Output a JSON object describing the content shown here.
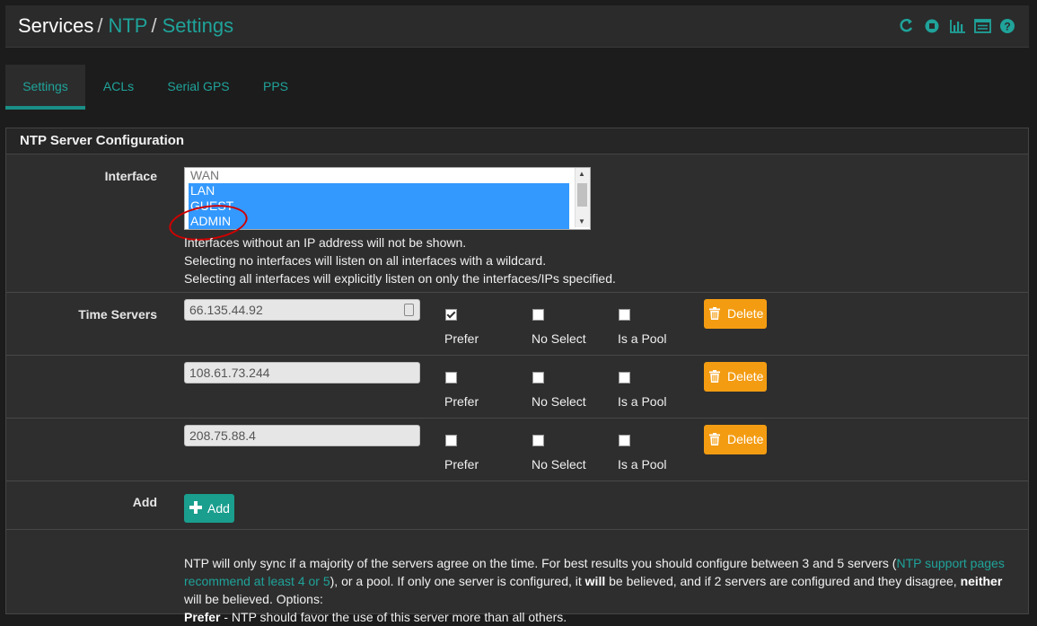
{
  "breadcrumb": {
    "part1": "Services",
    "part2": "NTP",
    "part3": "Settings",
    "sep": "/"
  },
  "header_icons": [
    "restart-service-icon",
    "stop-service-icon",
    "graph-icon",
    "log-icon",
    "help-icon"
  ],
  "tabs": [
    {
      "label": "Settings",
      "active": true
    },
    {
      "label": "ACLs"
    },
    {
      "label": "Serial GPS"
    },
    {
      "label": "PPS"
    }
  ],
  "panel": {
    "title": "NTP Server Configuration"
  },
  "interface": {
    "label": "Interface",
    "options": [
      {
        "label": "WAN",
        "selected": false
      },
      {
        "label": "LAN",
        "selected": true
      },
      {
        "label": "GUEST",
        "selected": true
      },
      {
        "label": "ADMIN",
        "selected": true
      }
    ],
    "help": [
      "Interfaces without an IP address will not be shown.",
      "Selecting no interfaces will listen on all interfaces with a wildcard.",
      "Selecting all interfaces will explicitly listen on only the interfaces/IPs specified."
    ]
  },
  "time_servers": {
    "label": "Time Servers",
    "prefer_label": "Prefer",
    "noselect_label": "No Select",
    "pool_label": "Is a Pool",
    "delete_label": "Delete",
    "rows": [
      {
        "address": "66.135.44.92",
        "prefer": true,
        "noselect": false,
        "pool": false
      },
      {
        "address": "108.61.73.244",
        "prefer": false,
        "noselect": false,
        "pool": false
      },
      {
        "address": "208.75.88.4",
        "prefer": false,
        "noselect": false,
        "pool": false
      }
    ]
  },
  "add": {
    "label": "Add",
    "button_label": "Add"
  },
  "info": {
    "t1": "NTP will only sync if a majority of the servers agree on the time. For best results you should configure between 3 and 5 servers (",
    "link": "NTP support pages recommend at least 4 or 5",
    "t2": "), or a pool. If only one server is configured, it ",
    "b1": "will",
    "t3": " be believed, and if 2 servers are configured and they disagree, ",
    "b2": "neither",
    "t4": " will be believed. Options:",
    "b3": "Prefer",
    "t5": " - NTP should favor the use of this server more than all others."
  },
  "colors": {
    "accent": "#1fa39a",
    "delete": "#f39c12",
    "add": "#1a9e8e",
    "selected": "#3399ff"
  }
}
